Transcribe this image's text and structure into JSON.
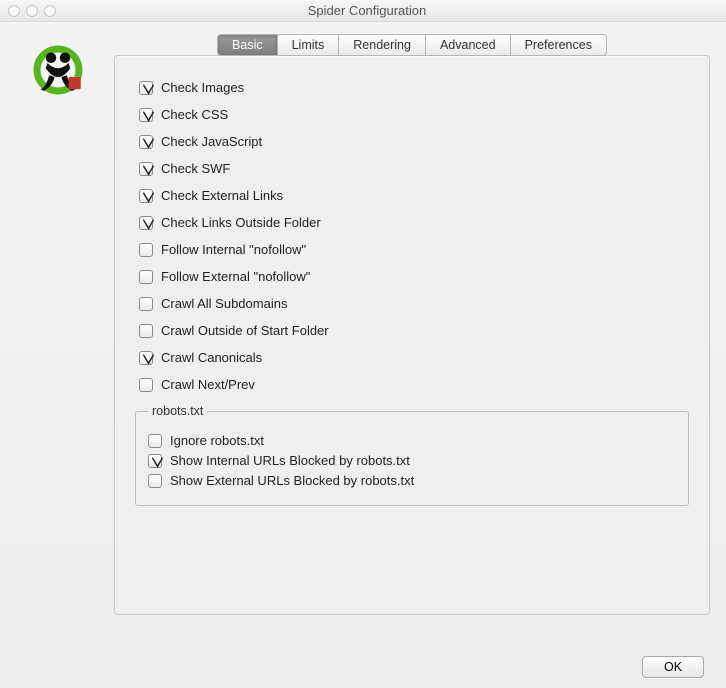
{
  "window": {
    "title": "Spider Configuration"
  },
  "tabs": [
    {
      "label": "Basic",
      "active": true
    },
    {
      "label": "Limits",
      "active": false
    },
    {
      "label": "Rendering",
      "active": false
    },
    {
      "label": "Advanced",
      "active": false
    },
    {
      "label": "Preferences",
      "active": false
    }
  ],
  "basic_options": [
    {
      "label": "Check Images",
      "checked": true
    },
    {
      "label": "Check CSS",
      "checked": true
    },
    {
      "label": "Check JavaScript",
      "checked": true
    },
    {
      "label": "Check SWF",
      "checked": true
    },
    {
      "label": "Check External Links",
      "checked": true
    },
    {
      "label": "Check Links Outside Folder",
      "checked": true
    },
    {
      "label": "Follow Internal \"nofollow\"",
      "checked": false
    },
    {
      "label": "Follow External \"nofollow\"",
      "checked": false
    },
    {
      "label": "Crawl All Subdomains",
      "checked": false
    },
    {
      "label": "Crawl Outside of Start Folder",
      "checked": false
    },
    {
      "label": "Crawl Canonicals",
      "checked": true
    },
    {
      "label": "Crawl Next/Prev",
      "checked": false
    }
  ],
  "robots": {
    "legend": "robots.txt",
    "options": [
      {
        "label": "Ignore robots.txt",
        "checked": false
      },
      {
        "label": "Show Internal URLs Blocked by robots.txt",
        "checked": true
      },
      {
        "label": "Show External URLs Blocked by robots.txt",
        "checked": false
      }
    ]
  },
  "footer": {
    "ok": "OK"
  }
}
